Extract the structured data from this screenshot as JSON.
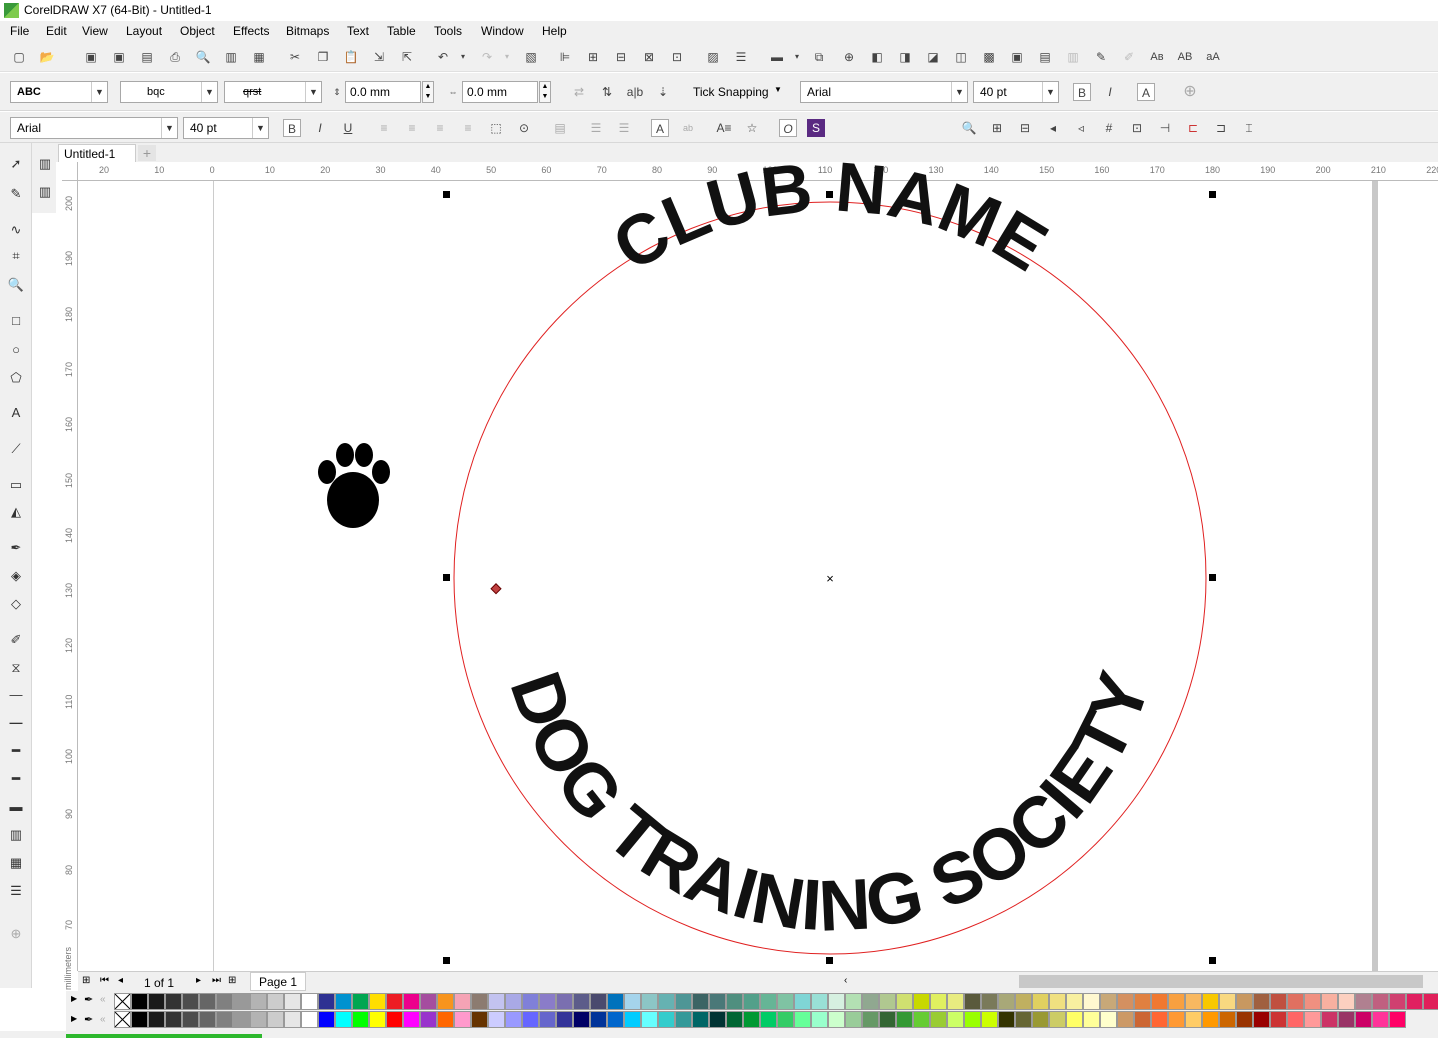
{
  "title_bar": {
    "title": "CorelDRAW X7 (64-Bit) - Untitled-1"
  },
  "menu": {
    "items": [
      "File",
      "Edit",
      "View",
      "Layout",
      "Object",
      "Effects",
      "Bitmaps",
      "Text",
      "Table",
      "Tools",
      "Window",
      "Help"
    ]
  },
  "property_bar1": {
    "text_style_sample1": "ABC",
    "text_style_sample2": "bqc",
    "text_style_sample3": "qrst",
    "offset1": "0.0 mm",
    "offset2": "0.0 mm",
    "tick_snapping": "Tick Snapping",
    "font": "Arial",
    "size": "40 pt"
  },
  "property_bar2": {
    "font": "Arial",
    "size": "40 pt"
  },
  "document": {
    "tab": "Untitled-1"
  },
  "ruler": {
    "unit": "millimeters",
    "top_ticks": [
      "20",
      "10",
      "0",
      "10",
      "20",
      "30",
      "40",
      "50",
      "60",
      "70",
      "80",
      "90",
      "100",
      "110",
      "120",
      "130",
      "140",
      "150",
      "160",
      "170",
      "180",
      "190",
      "200",
      "210",
      "220"
    ],
    "left_ticks": [
      "200",
      "190",
      "180",
      "170",
      "160",
      "150",
      "140",
      "130",
      "120",
      "110",
      "100",
      "90",
      "80",
      "70"
    ]
  },
  "artwork": {
    "top_text": "CLUB NAME",
    "bottom_text": "DOG TRAINING SOCIETY",
    "circle_color": "#e02020",
    "text_color": "#111111"
  },
  "page_nav": {
    "page_count": "1 of 1",
    "page_tab": "Page 1"
  },
  "palette": {
    "row1": [
      "#000000",
      "#1a1a1a",
      "#333333",
      "#4d4d4d",
      "#666666",
      "#808080",
      "#999999",
      "#b3b3b3",
      "#cccccc",
      "#e6e6e6",
      "#ffffff",
      "#2e3192",
      "#0092cf",
      "#00a651",
      "#ffde00",
      "#ed1c24",
      "#ec008c",
      "#a54d9f",
      "#f7941d",
      "#f5a3b5",
      "#8c7b70",
      "#c3c3f0",
      "#a9a9e6",
      "#8080d9",
      "#8a7cc9",
      "#7a6fb0",
      "#5c5c8a",
      "#4a4a6e",
      "#0072bc",
      "#a5d4ec",
      "#8cc6c6",
      "#66b2b2",
      "#4e9696",
      "#3c6464",
      "#4a7878",
      "#4f8f7f",
      "#52a08a",
      "#66b596",
      "#7fc3a3",
      "#7fd5d5",
      "#99e0d6",
      "#d6f0e0",
      "#b3e0b3",
      "#90a890",
      "#b0c890",
      "#d0e070",
      "#c8d800",
      "#e0f060",
      "#e8ec80",
      "#5a5a3c",
      "#7a7a5a",
      "#a8a878",
      "#c0b060",
      "#e0d060",
      "#f0e080",
      "#f8f0a0",
      "#fff8d0",
      "#c8a878",
      "#d49060",
      "#e08040",
      "#f07830",
      "#f8a040",
      "#f8b860",
      "#f8c800",
      "#f8d880",
      "#c89860",
      "#a06040",
      "#c05040",
      "#e07060",
      "#f09080",
      "#f8b0a0",
      "#fcd0c0",
      "#b08090",
      "#c06080",
      "#d04070",
      "#e02060",
      "#e0205a",
      "#f00040"
    ],
    "row2": [
      "#000000",
      "#1a1a1a",
      "#333333",
      "#4d4d4d",
      "#666666",
      "#808080",
      "#999999",
      "#b3b3b3",
      "#cccccc",
      "#e6e6e6",
      "#ffffff",
      "#0000ff",
      "#00ffff",
      "#00ff00",
      "#ffff00",
      "#ff0000",
      "#ff00ff",
      "#9933cc",
      "#ff6600",
      "#ff99cc",
      "#663300",
      "#ccccff",
      "#9999ff",
      "#6666ff",
      "#6666cc",
      "#333399",
      "#000066",
      "#003399",
      "#0066cc",
      "#00ccff",
      "#66ffff",
      "#33cccc",
      "#339999",
      "#006666",
      "#003333",
      "#006633",
      "#009933",
      "#00cc66",
      "#33cc66",
      "#66ff99",
      "#99ffcc",
      "#ccffcc",
      "#99cc99",
      "#669966",
      "#336633",
      "#339933",
      "#66cc33",
      "#99cc33",
      "#ccff66",
      "#99ff00",
      "#ccff00",
      "#333300",
      "#666633",
      "#999933",
      "#cccc66",
      "#ffff66",
      "#ffff99",
      "#ffffcc",
      "#cc9966",
      "#cc6633",
      "#ff6633",
      "#ff9933",
      "#ffcc66",
      "#ff9900",
      "#cc6600",
      "#993300",
      "#990000",
      "#cc3333",
      "#ff6666",
      "#ff9999",
      "#cc3366",
      "#993366",
      "#cc0066",
      "#ff3399",
      "#ff0066"
    ]
  }
}
